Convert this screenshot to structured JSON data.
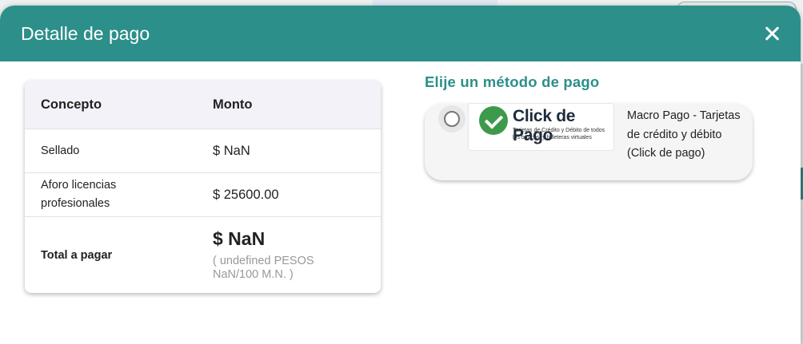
{
  "modal": {
    "title": "Detalle de pago"
  },
  "table": {
    "headers": {
      "concept": "Concepto",
      "amount": "Monto"
    },
    "rows": [
      {
        "concept": "Sellado",
        "amount": "$ NaN"
      },
      {
        "concept": "Aforo licencias profesionales",
        "amount": "$ 25600.00"
      }
    ],
    "total": {
      "label": "Total a pagar",
      "amount": "$ NaN",
      "in_words": "( undefined PESOS NaN/100 M.N. )"
    }
  },
  "payment": {
    "title": "Elije un método de pago",
    "options": [
      {
        "logo_title": "Click de Pago",
        "logo_subtitle": "Tarjetas de Crédito y Débito de todos los bancos, y billeteras virtuales",
        "label": "Macro Pago - Tarjetas de crédito y débito (Click de pago)",
        "selected": false
      }
    ]
  },
  "colors": {
    "header": "#2c8f8a",
    "accent_text": "#2c8f8a",
    "logo_check": "#3d9a4b"
  }
}
